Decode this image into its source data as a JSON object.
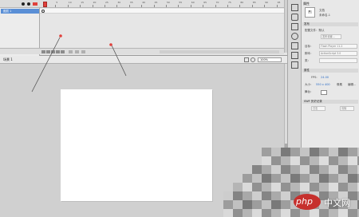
{
  "timeline": {
    "layer_name": "图层 1",
    "tick_labels": [
      "1",
      "5",
      "10",
      "15",
      "20",
      "25",
      "30",
      "35",
      "40",
      "45",
      "50",
      "55",
      "60",
      "65",
      "70",
      "75",
      "80",
      "85",
      "90",
      "95"
    ]
  },
  "edit_bar": {
    "scene_label": "场景 1",
    "zoom": "100%"
  },
  "properties": {
    "tab": "属性",
    "doc_icon": "Fl",
    "doc_type": "文档",
    "doc_name": "未命名-1",
    "section_publish": "发布",
    "profile_label": "配置文件：默认",
    "publish_settings": "发布设置...",
    "player_label": "目标：",
    "player_value": "Flash Player 11.2",
    "script_label": "脚本：",
    "script_value": "ActionScript 3.0",
    "class_label": "类：",
    "section_props": "属性",
    "fps_label": "FPS:",
    "fps_value": "24.00",
    "size_label": "大小：",
    "size_value": "550 x 400",
    "size_unit": "像素",
    "edit_label": "编辑...",
    "stage_label": "舞台：",
    "section_swf": "SWF 历史记录",
    "log_button": "日志",
    "clear_button": "清除"
  },
  "watermark": {
    "logo": "php",
    "site": "中文网"
  },
  "colors": {
    "stage": "#ffffff",
    "playhead": "#e0403b",
    "layer_selected": "#5a8fd6",
    "annotation": "#555555"
  }
}
